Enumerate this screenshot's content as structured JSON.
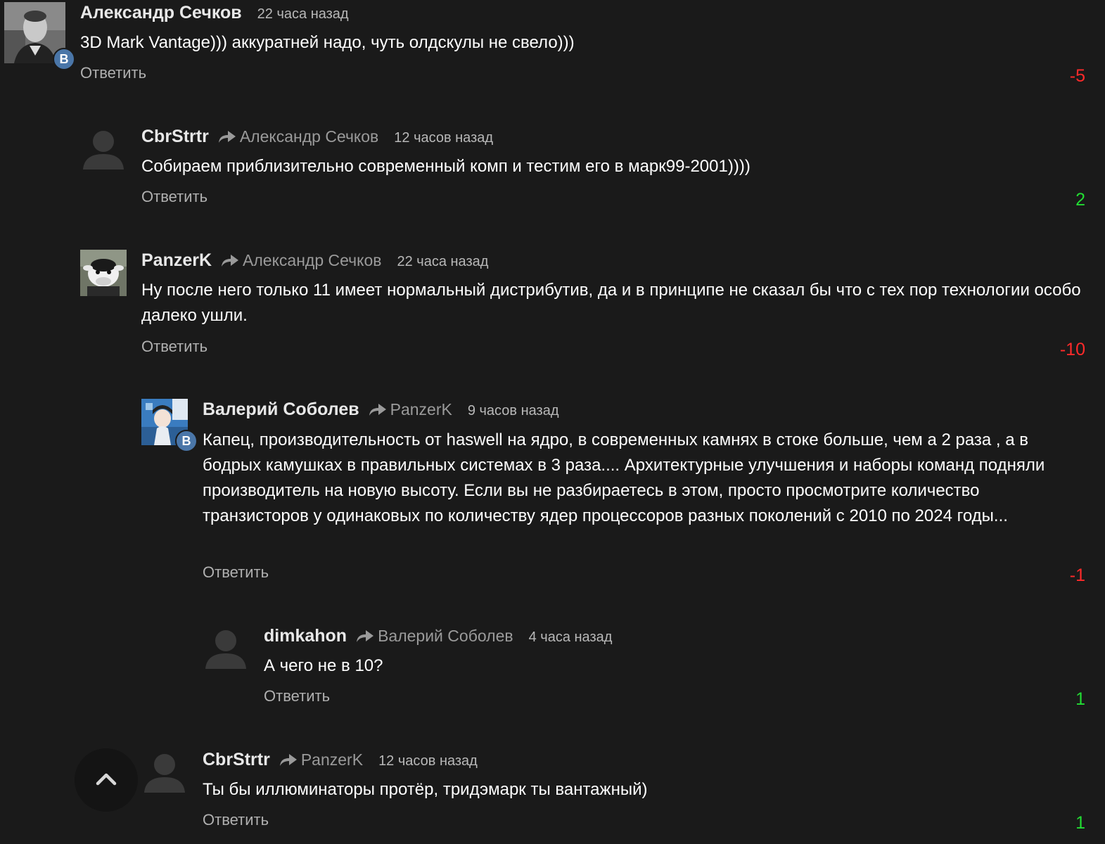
{
  "comments": [
    {
      "author": "Александр Сечков",
      "reply_to": "",
      "time": "22 часа назад",
      "text": "3D Mark Vantage))) аккуратней надо, чуть олдскулы не свело)))",
      "reply_label": "Ответить",
      "score": "-5",
      "avatar": "photo-portrait",
      "badge": "В"
    },
    {
      "author": "CbrStrtr",
      "reply_to": "Александр Сечков",
      "time": "12 часов назад",
      "text": "Собираем приблизительно современный комп и тестим его в марк99-2001))))",
      "reply_label": "Ответить",
      "score": "2",
      "avatar": "default-user"
    },
    {
      "author": "PanzerK",
      "reply_to": "Александр Сечков",
      "time": "22 часа назад",
      "text": "Ну после него только 11 имеет нормальный дистрибутив, да и в принципе не сказал бы что с тех пор технологии особо далеко ушли.",
      "reply_label": "Ответить",
      "score": "-10",
      "avatar": "cartoon-cow"
    },
    {
      "author": "Валерий Соболев",
      "reply_to": "PanzerK",
      "time": "9 часов назад",
      "text": "Капец, производительность от haswell на ядро, в современных камнях в стоке больше, чем а 2 раза , а в бодрых камушках в правильных системах в 3 раза....  Архитектурные улучшения и наборы команд подняли производитель на новую высоту. Если вы не разбираетесь в этом, просто просмотрите количество транзисторов у одинаковых по количеству ядер процессоров разных поколений с 2010 по 2024 годы...",
      "reply_label": "Ответить",
      "score": "-1",
      "avatar": "anime-picture",
      "badge": "В"
    },
    {
      "author": "dimkahon",
      "reply_to": "Валерий Соболев",
      "time": "4 часа назад",
      "text": "А чего не в 10?",
      "reply_label": "Ответить",
      "score": "1",
      "avatar": "default-user"
    },
    {
      "author": "CbrStrtr",
      "reply_to": "PanzerK",
      "time": "12 часов назад",
      "text": "Ты бы иллюминаторы протёр, тридэмарк ты вантажный)",
      "reply_label": "Ответить",
      "score": "1",
      "avatar": "default-user"
    }
  ],
  "icons": {
    "reply_arrow": "share-arrow-icon",
    "scroll_top": "chevron-up-icon"
  },
  "colors": {
    "background": "#1a1a1a",
    "score_negative": "#ff2a2a",
    "score_positive": "#22dd33",
    "vk_badge": "#4a76a8"
  }
}
